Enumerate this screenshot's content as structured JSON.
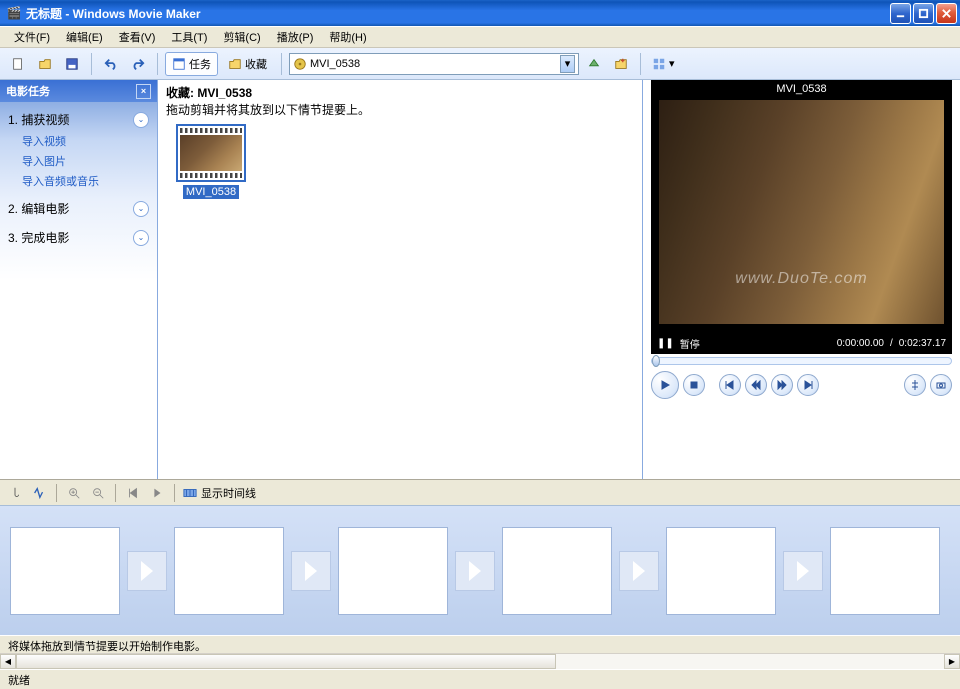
{
  "title": "无标题 - Windows Movie Maker",
  "menu": {
    "file": "文件(F)",
    "edit": "编辑(E)",
    "view": "查看(V)",
    "tools": "工具(T)",
    "clip": "剪辑(C)",
    "play": "播放(P)",
    "help": "帮助(H)"
  },
  "toolbar": {
    "tasks_label": "任务",
    "collections_label": "收藏",
    "collection_value": "MVI_0538"
  },
  "taskpane": {
    "header": "电影任务",
    "group1": {
      "title": "1. 捕获视频",
      "links": [
        "导入视频",
        "导入图片",
        "导入音频或音乐"
      ]
    },
    "group2": {
      "title": "2. 编辑电影"
    },
    "group3": {
      "title": "3. 完成电影"
    }
  },
  "collection": {
    "title_prefix": "收藏: ",
    "title_name": "MVI_0538",
    "hint": "拖动剪辑并将其放到以下情节提要上。",
    "clip_label": "MVI_0538"
  },
  "preview": {
    "caption": "MVI_0538",
    "pause_label": "暂停",
    "time_current": "0:00:00.00",
    "time_sep": " / ",
    "time_total": "0:02:37.17",
    "watermark": "www.DuoTe.com"
  },
  "timeline": {
    "toggle_label": "显示时间线"
  },
  "storyboard": {
    "hint": "将媒体拖放到情节提要以开始制作电影。"
  },
  "status": "就绪"
}
